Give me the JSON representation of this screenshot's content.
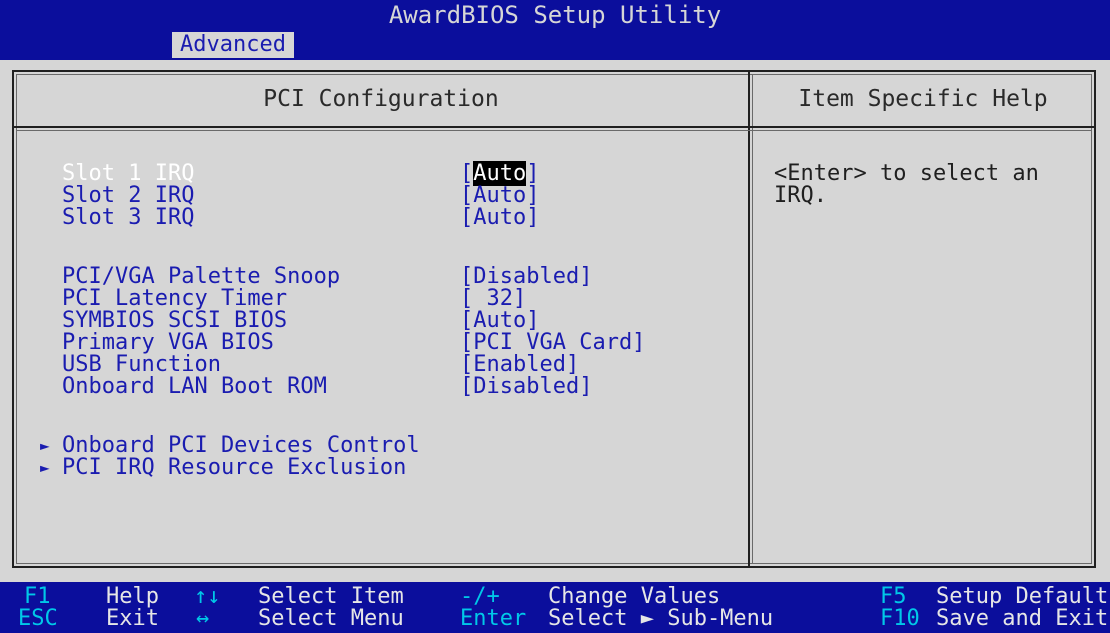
{
  "title": "AwardBIOS Setup Utility",
  "menu": {
    "active_tab": "Advanced"
  },
  "main_panel": {
    "title": "PCI Configuration"
  },
  "help_panel": {
    "title": "Item Specific Help",
    "text_line1": "<Enter> to select an",
    "text_line2": "IRQ."
  },
  "settings": [
    {
      "label": "Slot 1 IRQ",
      "value_pre": "[",
      "value_hl": "Auto",
      "value_post": "]"
    },
    {
      "label": "Slot 2 IRQ",
      "value": "[Auto]"
    },
    {
      "label": "Slot 3 IRQ",
      "value": "[Auto]"
    },
    {
      "label": "PCI/VGA Palette Snoop",
      "value": "[Disabled]"
    },
    {
      "label": "PCI Latency Timer",
      "value": "[ 32]"
    },
    {
      "label": "SYMBIOS SCSI BIOS",
      "value": "[Auto]"
    },
    {
      "label": "Primary VGA BIOS",
      "value": "[PCI VGA Card]"
    },
    {
      "label": "USB Function",
      "value": "[Enabled]"
    },
    {
      "label": "Onboard LAN Boot ROM",
      "value": "[Disabled]"
    }
  ],
  "submenus": [
    {
      "arrow": "►",
      "label": "Onboard PCI Devices Control"
    },
    {
      "arrow": "►",
      "label": "PCI IRQ Resource Exclusion"
    }
  ],
  "status_bar": {
    "f1_key": "F1",
    "f1_desc": "Help",
    "esc_key": "ESC",
    "esc_desc": "Exit",
    "updown_key": "↑↓",
    "updown_desc": "Select Item",
    "leftright_key": "↔",
    "leftright_desc": "Select Menu",
    "plusminus_key": "-/+",
    "plusminus_desc": "Change Values",
    "enter_key": "Enter",
    "enter_desc": "Select ► Sub-Menu",
    "f5_key": "F5",
    "f5_desc": "Setup Defaults",
    "f10_key": "F10",
    "f10_desc": "Save and Exit"
  },
  "colors": {
    "background": "#d6d6d6",
    "bar_blue": "#0b0e9c",
    "item_text": "#1a1cb0",
    "selected_text": "#ffffff",
    "status_key": "#00c8e8"
  }
}
